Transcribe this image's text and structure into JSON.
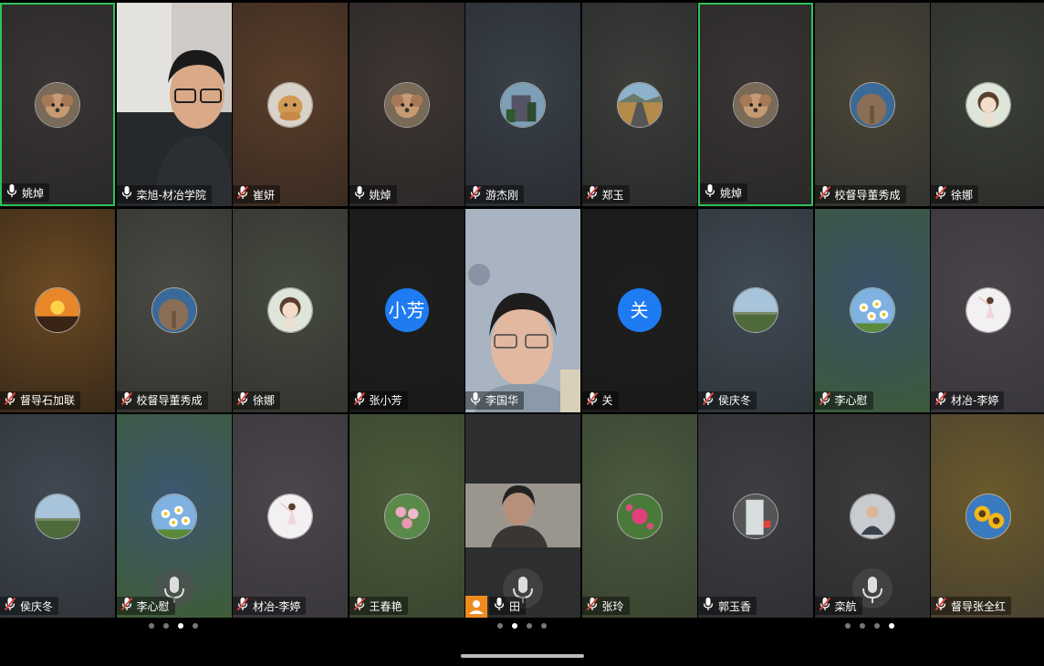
{
  "meeting": {
    "participants": [
      {
        "name": "姚焯",
        "mic": "on",
        "avatar": "poodle",
        "bg": [
          "#3a3535",
          "#2a2828"
        ],
        "active": true
      },
      {
        "name": "栾旭-材冶学院",
        "mic": "on",
        "avatar": "camera-man",
        "bg": [
          "#c9c6c2",
          "#3b3a3a"
        ]
      },
      {
        "name": "崔妍",
        "mic": "muted",
        "avatar": "golden-dog",
        "bg": [
          "#5a3e2a",
          "#3a2b22"
        ]
      },
      {
        "name": "姚焯",
        "mic": "on",
        "avatar": "poodle",
        "bg": [
          "#3e3632",
          "#2b2828"
        ]
      },
      {
        "name": "游杰刚",
        "mic": "muted",
        "avatar": "building",
        "bg": [
          "#394048",
          "#2a2e33"
        ]
      },
      {
        "name": "郑玉",
        "mic": "muted",
        "avatar": "road",
        "bg": [
          "#3c3e3a",
          "#2a2b2c"
        ]
      },
      {
        "name": "姚焯",
        "mic": "on",
        "avatar": "poodle",
        "bg": [
          "#3a3535",
          "#2a2828"
        ],
        "active": true
      },
      {
        "name": "校督导董秀成",
        "mic": "muted",
        "avatar": "elephant",
        "bg": [
          "#4a4536",
          "#333330"
        ]
      },
      {
        "name": "徐娜",
        "mic": "muted",
        "avatar": "anime-girl",
        "bg": [
          "#3c4038",
          "#2c2e2b"
        ]
      },
      {
        "name": "督导石加联",
        "mic": "muted",
        "avatar": "sunset",
        "bg": [
          "#6b4a22",
          "#3a2a1a"
        ]
      },
      {
        "name": "校督导董秀成",
        "mic": "muted",
        "avatar": "elephant",
        "bg": [
          "#4a4a44",
          "#34352f"
        ]
      },
      {
        "name": "徐娜",
        "mic": "muted",
        "avatar": "anime-girl",
        "bg": [
          "#454a40",
          "#33352f"
        ]
      },
      {
        "name": "张小芳",
        "mic": "muted",
        "initials": "小芳",
        "bg": [
          "#1e1e1e",
          "#1a1a1a"
        ]
      },
      {
        "name": "李国华",
        "mic": "on",
        "avatar": "camera-woman",
        "bg": [
          "#9aa6b6",
          "#6e6e72"
        ]
      },
      {
        "name": "关",
        "mic": "muted",
        "initials": "关",
        "bg": [
          "#1e1e1e",
          "#1a1a1a"
        ]
      },
      {
        "name": "侯庆冬",
        "mic": "muted",
        "avatar": "field",
        "bg": [
          "#3f4a55",
          "#30363b"
        ]
      },
      {
        "name": "李心慰",
        "mic": "muted",
        "avatar": "daisies",
        "bg": [
          "#3a5068",
          "#3c5a3a"
        ]
      },
      {
        "name": "材冶-李婷",
        "mic": "muted",
        "avatar": "dancer",
        "bg": [
          "#48444a",
          "#3a373c"
        ]
      },
      {
        "name": "侯庆冬",
        "mic": "muted",
        "avatar": "field",
        "bg": [
          "#404852",
          "#30353a"
        ]
      },
      {
        "name": "李心慰",
        "mic": "muted",
        "avatar": "daisies",
        "bg": [
          "#3d5670",
          "#3e5c36"
        ]
      },
      {
        "name": "材冶-李婷",
        "mic": "muted",
        "avatar": "dancer",
        "bg": [
          "#4a464c",
          "#3a373c"
        ]
      },
      {
        "name": "王春艳",
        "mic": "muted",
        "avatar": "pink-flowers",
        "bg": [
          "#4a5a3a",
          "#3a4630"
        ]
      },
      {
        "name": "田",
        "mic": "on",
        "avatar": "camera-woman2",
        "bg": [
          "#2e2f30",
          "#2a2b2c"
        ]
      },
      {
        "name": "张玲",
        "mic": "muted",
        "avatar": "rose",
        "bg": [
          "#4a5a40",
          "#3a4430"
        ]
      },
      {
        "name": "郭玉香",
        "mic": "on",
        "avatar": "waterfall",
        "bg": [
          "#3c3e42",
          "#2e3033"
        ]
      },
      {
        "name": "栾航",
        "mic": "muted",
        "avatar": "man-photo",
        "bg": [
          "#3c3a3a",
          "#2e2d2d"
        ]
      },
      {
        "name": "督导张全红",
        "mic": "muted",
        "avatar": "sunflowers",
        "bg": [
          "#6a5a2a",
          "#4a4230"
        ]
      }
    ]
  },
  "pagers": [
    {
      "count": 4,
      "active": 2
    },
    {
      "count": 4,
      "active": 1
    },
    {
      "count": 4,
      "active": 3
    }
  ],
  "colors": {
    "active_border": "#2fc15a",
    "initials_bg": "#1f7bf2",
    "muted_red": "#e0453d"
  }
}
